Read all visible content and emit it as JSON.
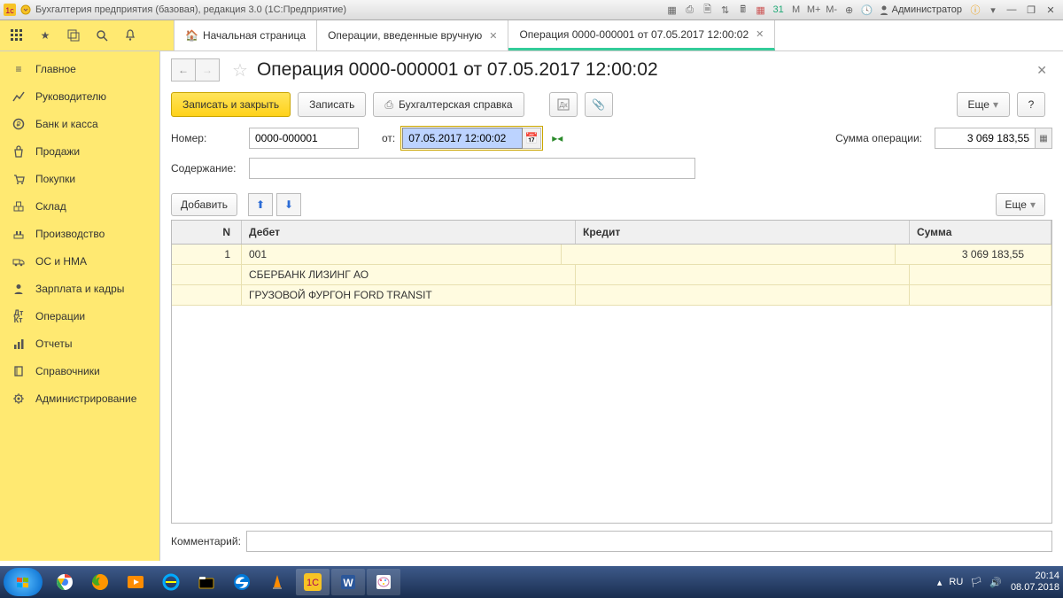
{
  "titlebar": {
    "title": "Бухгалтерия предприятия (базовая), редакция 3.0  (1С:Предприятие)",
    "user_label": "Администратор"
  },
  "tabs": [
    {
      "label": "Начальная страница",
      "icon": "home"
    },
    {
      "label": "Операции, введенные вручную"
    },
    {
      "label": "Операция 0000-000001 от 07.05.2017 12:00:02",
      "active": true
    }
  ],
  "sidebar": {
    "items": [
      {
        "label": "Главное",
        "icon": "menu"
      },
      {
        "label": "Руководителю",
        "icon": "chart"
      },
      {
        "label": "Банк и касса",
        "icon": "coin"
      },
      {
        "label": "Продажи",
        "icon": "bag"
      },
      {
        "label": "Покупки",
        "icon": "cart"
      },
      {
        "label": "Склад",
        "icon": "boxes"
      },
      {
        "label": "Производство",
        "icon": "gear"
      },
      {
        "label": "ОС и НМА",
        "icon": "truck"
      },
      {
        "label": "Зарплата и кадры",
        "icon": "person"
      },
      {
        "label": "Операции",
        "icon": "dk"
      },
      {
        "label": "Отчеты",
        "icon": "bars"
      },
      {
        "label": "Справочники",
        "icon": "book"
      },
      {
        "label": "Администрирование",
        "icon": "wrench"
      }
    ]
  },
  "document": {
    "title": "Операция 0000-000001 от 07.05.2017 12:00:02",
    "buttons": {
      "save_close": "Записать и закрыть",
      "save": "Записать",
      "print_report": "Бухгалтерская справка",
      "add": "Добавить",
      "more": "Еще"
    },
    "fields": {
      "number_label": "Номер:",
      "number_value": "0000-000001",
      "date_label": "от:",
      "date_value": "07.05.2017 12:00:02",
      "sum_label": "Сумма операции:",
      "sum_value": "3 069 183,55",
      "content_label": "Содержание:",
      "content_value": "",
      "comment_label": "Комментарий:",
      "comment_value": ""
    },
    "grid": {
      "headers": {
        "n": "N",
        "debit": "Дебет",
        "credit": "Кредит",
        "sum": "Сумма"
      },
      "rows": [
        {
          "n": "1",
          "debit_account": "001",
          "debit_sub1": "СБЕРБАНК ЛИЗИНГ АО",
          "debit_sub2": "ГРУЗОВОЙ ФУРГОН FORD TRANSIT",
          "credit": "",
          "sum": "3 069 183,55"
        }
      ]
    }
  },
  "taskbar": {
    "lang": "RU",
    "time": "20:14",
    "date": "08.07.2018"
  }
}
